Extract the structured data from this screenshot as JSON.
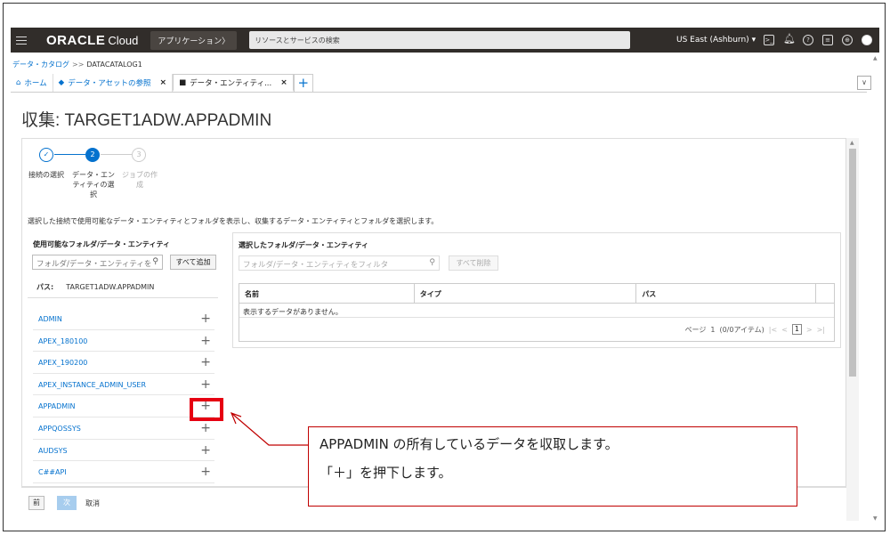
{
  "topbar": {
    "logo": "ORACLE",
    "logo_cloud": "Cloud",
    "apps_button": "アプリケーション〉",
    "search_placeholder": "リソースとサービスの検索",
    "region": "US East (Ashburn)",
    "region_chevron": "▾",
    "icons": [
      "cloud-shell-icon",
      "bell-icon",
      "help-icon",
      "chat-icon",
      "globe-icon",
      "user-icon"
    ]
  },
  "breadcrumb": {
    "root": "データ・カタログ",
    "separator": ">>",
    "current": "DATACATALOG1"
  },
  "tabs": [
    {
      "label": "ホーム"
    },
    {
      "label": "データ・アセットの参照"
    },
    {
      "label": "データ・エンティティ..."
    }
  ],
  "tab_close": "×",
  "tab_add": "+",
  "page_title": "収集: TARGET1ADW.APPADMIN",
  "stepper": {
    "steps": [
      {
        "number": "✓",
        "label": "接続の選択"
      },
      {
        "number": "2",
        "label": "データ・エンティティの選択"
      },
      {
        "number": "3",
        "label": "ジョブの作成"
      }
    ]
  },
  "description": "選択した接続で使用可能なデータ・エンティティとフォルダを表示し、収集するデータ・エンティティとフォルダを選択します。",
  "left_pane": {
    "title": "使用可能なフォルダ/データ・エンティティ",
    "filter_placeholder": "フォルダ/データ・エンティティを",
    "add_all": "すべて追加",
    "path_label": "パス:",
    "path_value": "TARGET1ADW.APPADMIN",
    "items": [
      "ADMIN",
      "APEX_180100",
      "APEX_190200",
      "APEX_INSTANCE_ADMIN_USER",
      "APPADMIN",
      "APPQOSSYS",
      "AUDSYS",
      "C##API"
    ],
    "plus": "+"
  },
  "right_pane": {
    "title": "選択したフォルダ/データ・エンティティ",
    "filter_placeholder": "フォルダ/データ・エンティティをフィルタ",
    "remove_all": "すべて削除",
    "columns": [
      "名前",
      "タイプ",
      "パス"
    ],
    "empty_message": "表示するデータがありません。",
    "pager": {
      "label": "ページ",
      "page": "1",
      "items": "(0/0アイテム)",
      "current": "1"
    }
  },
  "footer": {
    "prev": "前",
    "next": "次",
    "cancel": "取消"
  },
  "annotation": {
    "line1": "APPADMIN の所有しているデータを収取します。",
    "line2": "「＋」を押下します。",
    "color": "#e60012"
  },
  "colors": {
    "topbar": "#312d2a",
    "link": "#0572ce",
    "highlight": "#e60012"
  }
}
